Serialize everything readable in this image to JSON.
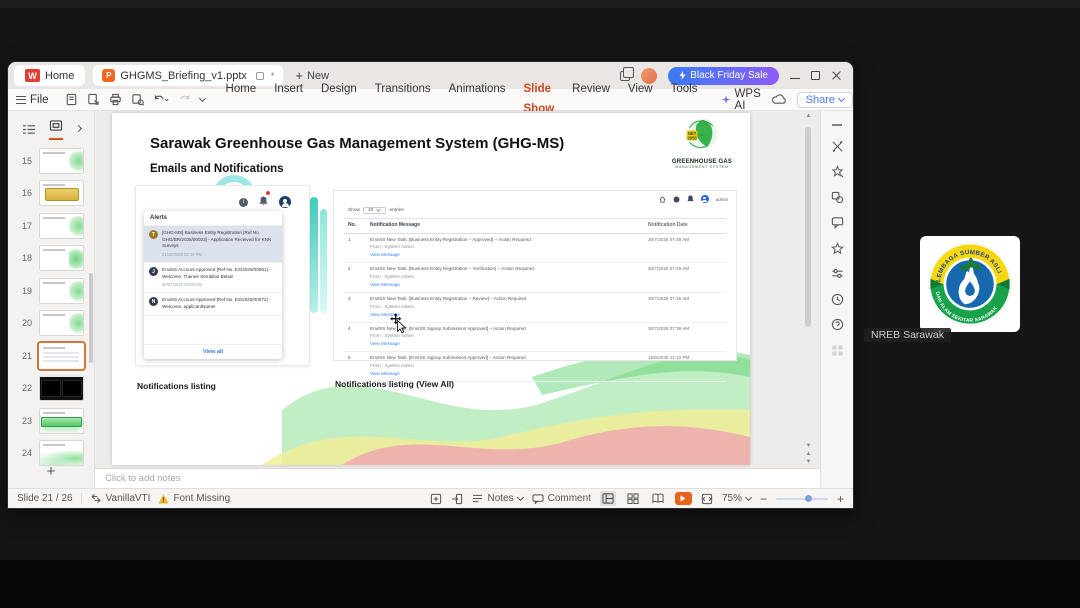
{
  "colors": {
    "accent": "#c9491f",
    "promo_start": "#3a7bf7",
    "promo_end": "#8b5cf6",
    "share_blue": "#4a7af0",
    "link_blue": "#3b82f6",
    "play_button": "#e8641c",
    "selected_thumb_border": "#d4753c"
  },
  "titlebar": {
    "wps_logo_letter": "W",
    "home_tab": "Home",
    "ppt_icon_letter": "P",
    "doc_tab": "GHGMS_Briefing_v1.pptx",
    "modified_marker": "*",
    "new_plus": "+",
    "new_label": "New",
    "promo_label": "Black Friday Sale"
  },
  "menubar": {
    "file_label": "File",
    "items": [
      "Home",
      "Insert",
      "Design",
      "Transitions",
      "Animations",
      "Slide Show",
      "Review",
      "View",
      "Tools"
    ],
    "wps_ai_label": "WPS AI",
    "share_label": "Share"
  },
  "sidebar": {
    "numbers": [
      "15",
      "16",
      "17",
      "18",
      "19",
      "20",
      "21",
      "22",
      "23",
      "24"
    ],
    "add_label": "+"
  },
  "slide": {
    "title": "Sarawak Greenhouse Gas Management System (GHG-MS)",
    "subtitle": "Emails and Notifications",
    "logo": {
      "badge_line1": "NET",
      "badge_line2": "2050",
      "name_line1": "GREENHOUSE GAS",
      "name_line2": "MANAGEMENT SYSTEM"
    },
    "alerts": {
      "header": "Alerts",
      "items": [
        {
          "avatar": "T",
          "avatar_color": "#9c7b23",
          "text": "[GHG-MS] Business Entity Registration [Ref No. GHG/BR/2025/00023] - Application Received for KNN Surveys",
          "date": "21/10/2025 02:19 PM"
        },
        {
          "avatar": "J",
          "avatar_color": "#2f3b4c",
          "text": "EnviSS Account Approved [Ref No. ES/2025/00081] - Welcome, Trainee Sembilan Belas!",
          "date": "30/07/2025 09:09 AM"
        },
        {
          "avatar": "N",
          "avatar_color": "#2f3b4c",
          "text": "EnviSS Account Approved [Ref No. ES/2025/00072] - Welcome, applicantName!",
          "date": ""
        }
      ],
      "view_all": "View all"
    },
    "notifications_table": {
      "admin_label": "admin",
      "show_prefix": "Show",
      "show_value": "10",
      "show_suffix": "entries",
      "columns": [
        "No.",
        "Notification Message",
        "Notification Date"
      ],
      "from_label": "From : System Admin",
      "link_label": "View Message",
      "rows": [
        {
          "no": "1",
          "message": "EnvISS New Task: [Business Entity Registration – Approved] – Action Required",
          "date": "30/7/2025 07:49 AM"
        },
        {
          "no": "2",
          "message": "EnvISS New Task: [Business Entity Registration – Verification] – Action Required",
          "date": "30/7/2025 07:48 AM"
        },
        {
          "no": "3",
          "message": "EnvISS New Task: [Business Entity Registration – Review] – Action Required",
          "date": "30/7/2025 07:46 AM"
        },
        {
          "no": "4",
          "message": "EnvISS New Task: [EnvISS Signup Submission Approved] – Action Required",
          "date": "30/7/2025 07:39 AM"
        },
        {
          "no": "5",
          "message": "EnvISS New Task: [EnvISS Signup Submission Approved] – Action Required",
          "date": "16/6/2025 12:10 PM"
        }
      ]
    },
    "captions": {
      "left": "Notifications listing",
      "right": "Notifications listing (View All)"
    }
  },
  "notes": {
    "placeholder": "Click to add notes"
  },
  "statusbar": {
    "slide_indicator": "Slide 21 / 26",
    "theme_name": "VanillaVTI",
    "font_missing": "Font Missing",
    "notes_label": "Notes",
    "comment_label": "Comment",
    "zoom_value": "75%"
  },
  "participant": {
    "name": "NREB Sarawak",
    "emblem_top": "LEMBAGA SUMBER ASLI",
    "emblem_bottom": "DAN ALAM SEKITAR SARAWAK"
  }
}
